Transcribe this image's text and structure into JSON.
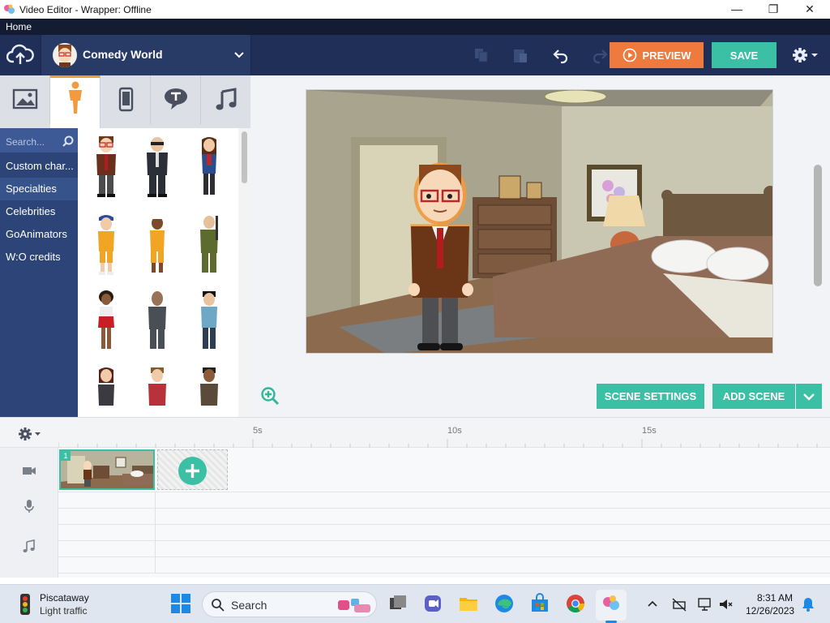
{
  "window": {
    "title": "Video Editor - Wrapper: Offline",
    "minimize_glyph": "—",
    "maximize_glyph": "❐",
    "close_glyph": "✕"
  },
  "menubar": {
    "home": "Home"
  },
  "toolbar": {
    "movie_title": "Comedy World",
    "preview_label": "PREVIEW",
    "save_label": "SAVE"
  },
  "library": {
    "tabs": [
      "image-icon",
      "character-icon",
      "phone-icon",
      "speech-bubble-icon",
      "music-note-icon"
    ],
    "active_tab": 1,
    "search_placeholder": "Search...",
    "categories": [
      "Custom char...",
      "Specialties",
      "Celebrities",
      "GoAnimators",
      "W:O credits"
    ],
    "selected_category": 1
  },
  "stage": {
    "scene_settings_label": "SCENE SETTINGS",
    "add_scene_label": "ADD SCENE"
  },
  "timeline": {
    "ticks": [
      "5s",
      "10s",
      "15s"
    ],
    "scene_number": "1",
    "tracks": [
      "video-camera-icon",
      "microphone-icon",
      "music-note-icon"
    ]
  },
  "taskbar": {
    "weather_title": "Piscataway",
    "weather_sub": "Light traffic",
    "search_placeholder": "Search",
    "time": "8:31 AM",
    "date": "12/26/2023"
  },
  "colors": {
    "accent": "#3bbfa5",
    "preview": "#ef7a3e",
    "toolbar": "#1f2f58",
    "sidebar": "#2c4478"
  }
}
